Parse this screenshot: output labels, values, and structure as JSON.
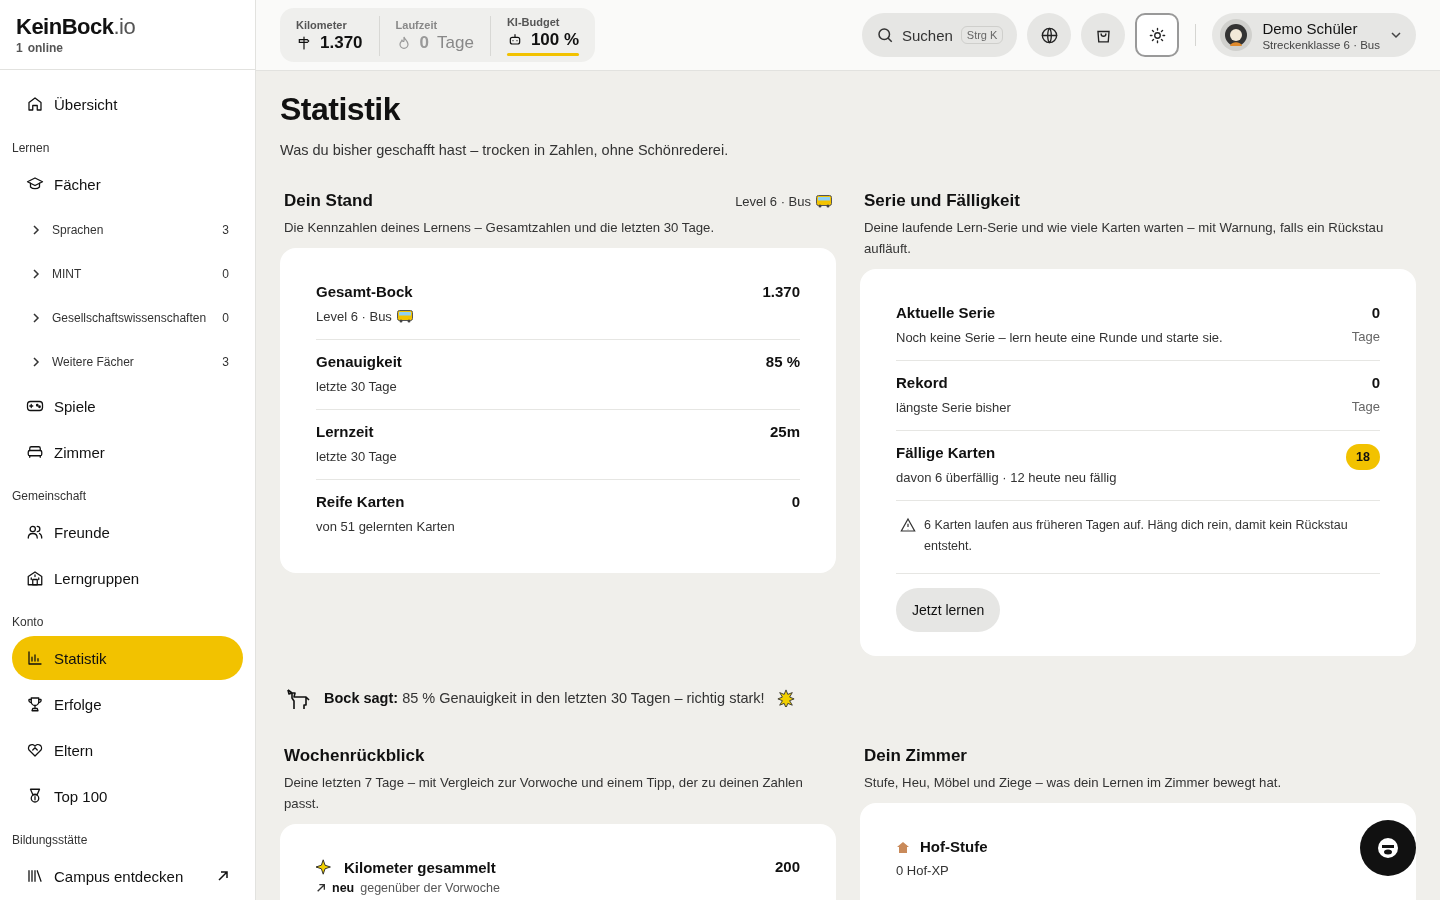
{
  "brand": {
    "name": "KeinBock",
    "tld": ".io",
    "online_count": "1",
    "online_label": "online"
  },
  "stats": [
    {
      "label": "Kilometer",
      "value": "1.370",
      "muted": false
    },
    {
      "label": "Laufzeit",
      "value": "0",
      "unit": "Tage",
      "muted": true
    },
    {
      "label": "KI-Budget",
      "value": "100 %",
      "muted": false,
      "level": 1
    }
  ],
  "search": {
    "label": "Suchen",
    "shortcut": "Strg K"
  },
  "header_buttons": [
    {
      "selected": false
    },
    {
      "selected": false
    },
    {
      "selected": true
    }
  ],
  "user": {
    "name": "Demo Schüler",
    "subtitle": "Streckenklasse 6 · Bus"
  },
  "sidebar": {
    "groups": [
      {
        "items": [
          {
            "label": "Übersicht",
            "selected": false
          }
        ]
      },
      {
        "heading": "Lernen",
        "items": [
          {
            "label": "Fächer",
            "selected": false,
            "children": [
              {
                "label": "Sprachen",
                "count": "3",
                "expanded": false
              },
              {
                "label": "MINT",
                "count": "0",
                "expanded": false
              },
              {
                "label": "Gesellschaftswissenschaften",
                "count": "0",
                "expanded": false
              },
              {
                "label": "Weitere Fächer",
                "count": "3",
                "expanded": false
              }
            ]
          },
          {
            "label": "Spiele",
            "selected": false
          },
          {
            "label": "Zimmer",
            "selected": false
          }
        ]
      },
      {
        "heading": "Gemeinschaft",
        "items": [
          {
            "label": "Freunde",
            "selected": false
          },
          {
            "label": "Lerngruppen",
            "selected": false
          }
        ]
      },
      {
        "heading": "Konto",
        "items": [
          {
            "label": "Statistik",
            "selected": true
          },
          {
            "label": "Erfolge",
            "selected": false
          },
          {
            "label": "Eltern",
            "selected": false
          },
          {
            "label": "Top 100",
            "selected": false
          }
        ]
      },
      {
        "heading": "Bildungsstätte",
        "items": [
          {
            "label": "Campus entdecken",
            "selected": false,
            "external": true
          }
        ]
      }
    ]
  },
  "page": {
    "title": "Statistik",
    "subtitle": "Was du bisher geschafft hast – trocken in Zahlen, ohne Schönrederei."
  },
  "stand": {
    "title": "Dein Stand",
    "meta": "Level 6 · Bus",
    "description": "Die Kennzahlen deines Lernens – Gesamtzahlen und die letzten 30 Tage.",
    "rows": [
      {
        "label": "Gesamt-Bock",
        "sub": "Level 6 · Bus",
        "bus": true,
        "value": "1.370"
      },
      {
        "label": "Genauigkeit",
        "sub": "letzte 30 Tage",
        "bus": false,
        "value": "85 %"
      },
      {
        "label": "Lernzeit",
        "sub": "letzte 30 Tage",
        "bus": false,
        "value": "25m"
      },
      {
        "label": "Reife Karten",
        "sub": "von 51 gelernten Karten",
        "bus": false,
        "value": "0"
      }
    ]
  },
  "serie": {
    "title": "Serie und Fälligkeit",
    "description": "Deine laufende Lern-Serie und wie viele Karten warten – mit Warnung, falls ein Rückstau aufläuft.",
    "rows": [
      {
        "kind": "count",
        "label": "Aktuelle Serie",
        "sub": "Noch keine Serie – lern heute eine Runde und starte sie.",
        "value": "0",
        "unit": "Tage"
      },
      {
        "kind": "count",
        "label": "Rekord",
        "sub": "längste Serie bisher",
        "value": "0",
        "unit": "Tage"
      },
      {
        "kind": "badge",
        "label": "Fällige Karten",
        "sub": "davon 6 überfällig · 12 heute neu fällig",
        "value": "18"
      }
    ],
    "warning": "6 Karten laufen aus früheren Tagen auf. Häng dich rein, damit kein Rückstau entsteht.",
    "button": "Jetzt lernen"
  },
  "bock": {
    "text": "**Bock sagt:** 85 % Genauigkeit in den letzten 30 Tagen – richtig stark!"
  },
  "wochen": {
    "title": "Wochenrückblick",
    "description": "Deine letzten 7 Tage – mit Vergleich zur Vorwoche und einem Tipp, der zu deinen Zahlen passt.",
    "rows": [
      {
        "label": "Kilometer gesammelt",
        "value": "200",
        "trend": "neu",
        "trend_text": "gegenüber der Vorwoche"
      }
    ]
  },
  "zimmer": {
    "title": "Dein Zimmer",
    "description": "Stufe, Heu, Möbel und Ziege – was dein Lernen im Zimmer bewegt hat.",
    "rows": [
      {
        "label": "Hof-Stufe",
        "sub": "0 Hof-XP"
      }
    ]
  }
}
